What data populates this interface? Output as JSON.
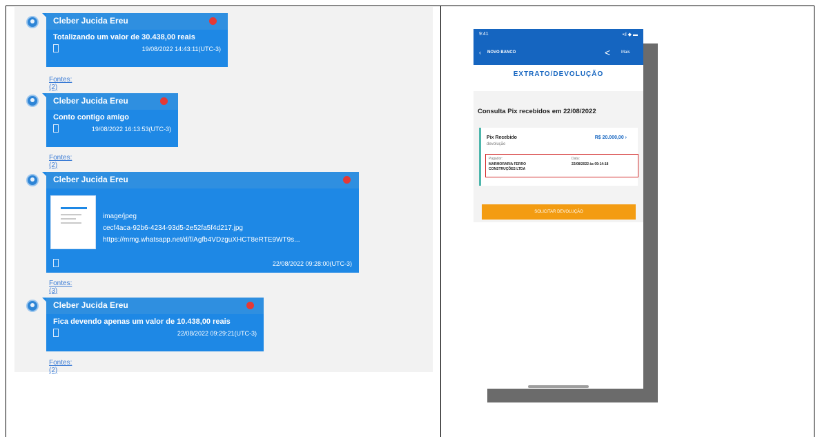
{
  "chat": {
    "messages": [
      {
        "sender": "Cleber Jucida Ereu",
        "text": "Totalizando um valor de 30.438,00 reais",
        "time": "19/08/2022 14:43:11(UTC-3)",
        "sources": "Fontes: (2)"
      },
      {
        "sender": "Cleber Jucida Ereu",
        "text": "Conto contigo amigo",
        "time": "19/08/2022 16:13:53(UTC-3)",
        "sources": "Fontes: (2)"
      },
      {
        "sender": "Cleber Jucida Ereu",
        "attachment": {
          "filename": "image/jpeg",
          "file": "cecf4aca-92b6-4234-93d5-2e52fa5f4d217.jpg",
          "url": "https://mmg.whatsapp.net/d/f/Agfb4VDzguXHCT8eRTE9WT9s..."
        },
        "time": "22/08/2022 09:28:00(UTC-3)",
        "sources": "Fontes: (3)"
      },
      {
        "sender": "Cleber Jucida Ereu",
        "text": "Fica devendo apenas um valor de 10.438,00 reais",
        "time": "22/08/2022 09:29:21(UTC-3)",
        "sources": "Fontes: (2)"
      }
    ]
  },
  "phone": {
    "status_time": "9:41",
    "status_right": "•ıl ◆ ▬",
    "nav_back": "‹",
    "nav_title": "NOVO BANCO",
    "nav_more": "Mais",
    "screen_title": "EXTRATO/DEVOLUÇÃO",
    "heading": "Consulta Pix recebidos em 22/08/2022",
    "card": {
      "type": "Pix Recebido",
      "subtype": "devolução",
      "amount": "R$ 20.000,00 ›",
      "payer_label": "Pagador:",
      "payer_value": "MARMORARIA FERRO CONSTRUÇÕES LTDA",
      "date_label": "Data:",
      "date_value": "22/08/2022 às 09:14:18"
    },
    "button_label": "SOLICITAR DEVOLUÇÃO"
  },
  "colors": {
    "bubble": "#1e88e5",
    "phone_header": "#1565c0",
    "highlight_box": "#d32f2f",
    "button": "#f39c12"
  }
}
